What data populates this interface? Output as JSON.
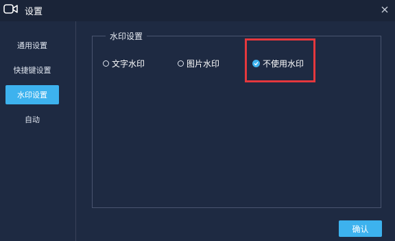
{
  "window": {
    "title": "设置"
  },
  "sidebar": {
    "items": [
      {
        "label": "通用设置"
      },
      {
        "label": "快捷键设置"
      },
      {
        "label": "水印设置"
      },
      {
        "label": "自动"
      }
    ]
  },
  "watermark": {
    "group_title": "水印设置",
    "options": [
      {
        "label": "文字水印",
        "checked": false
      },
      {
        "label": "图片水印",
        "checked": false
      },
      {
        "label": "不使用水印",
        "checked": true
      }
    ]
  },
  "footer": {
    "confirm_label": "确认"
  },
  "colors": {
    "accent": "#3db2ee",
    "highlight": "#e5383d",
    "background": "#1e2a42"
  }
}
